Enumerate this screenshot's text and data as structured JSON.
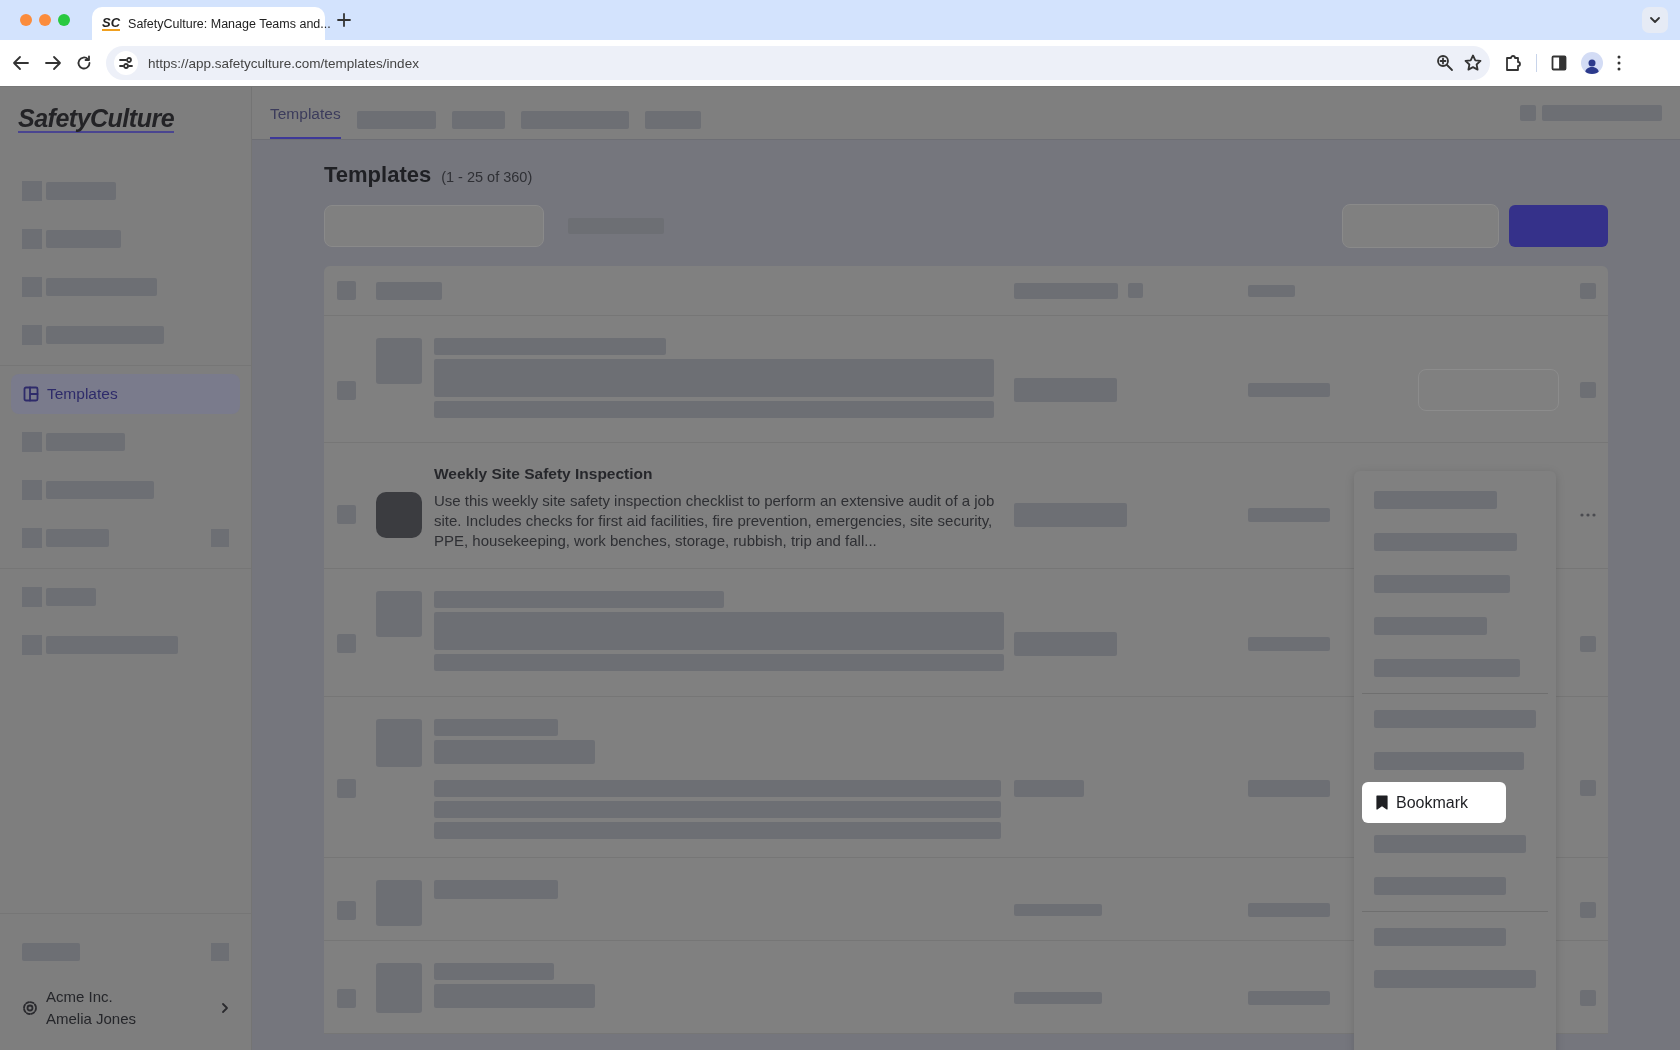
{
  "browser": {
    "favicon": "SC",
    "tab_title": "SafetyCulture: Manage Teams and...",
    "url": "https://app.safetyculture.com/templates/index"
  },
  "sidebar": {
    "logo": "SafetyCulture",
    "groups": [
      [
        {
          "kind": "placeholder",
          "selected": false
        },
        {
          "kind": "placeholder",
          "selected": false
        },
        {
          "kind": "placeholder",
          "selected": false
        },
        {
          "kind": "placeholder",
          "selected": false
        }
      ],
      [
        {
          "kind": "link",
          "label": "Templates",
          "selected": true
        },
        {
          "kind": "placeholder",
          "selected": false
        },
        {
          "kind": "placeholder",
          "selected": false
        },
        {
          "kind": "placeholder",
          "selected": false
        }
      ],
      [
        {
          "kind": "placeholder",
          "selected": false
        },
        {
          "kind": "placeholder",
          "selected": false
        }
      ]
    ],
    "account": {
      "org": "Acme Inc.",
      "user": "Amelia Jones"
    }
  },
  "header_tabs": [
    {
      "kind": "tab",
      "label": "Templates",
      "selected": true
    },
    {
      "kind": "placeholder",
      "selected": false
    },
    {
      "kind": "placeholder",
      "selected": false
    },
    {
      "kind": "placeholder",
      "selected": false
    },
    {
      "kind": "placeholder",
      "selected": false
    }
  ],
  "page": {
    "title": "Templates",
    "count": "(1 - 25 of 360)"
  },
  "table": {
    "rows": [
      {
        "kind": "placeholder"
      },
      {
        "kind": "template",
        "title": "Weekly Site Safety Inspection",
        "description": "Use this weekly site safety inspection checklist to perform an extensive audit of a job site. Includes checks for first aid facilities, fire prevention, emergencies, site security, PPE, housekeeping, work benches, storage, rubbish, trip and fall...",
        "menu_open": true
      },
      {
        "kind": "placeholder"
      },
      {
        "kind": "placeholder"
      },
      {
        "kind": "placeholder"
      },
      {
        "kind": "placeholder"
      }
    ]
  },
  "menu": {
    "items": [
      {
        "kind": "placeholder"
      },
      {
        "kind": "placeholder"
      },
      {
        "kind": "placeholder"
      },
      {
        "kind": "placeholder"
      },
      {
        "kind": "placeholder"
      },
      {
        "kind": "divider"
      },
      {
        "kind": "placeholder"
      },
      {
        "kind": "placeholder"
      },
      {
        "kind": "action",
        "label": "Bookmark",
        "highlighted": true
      },
      {
        "kind": "placeholder"
      },
      {
        "kind": "placeholder"
      },
      {
        "kind": "divider"
      },
      {
        "kind": "placeholder"
      },
      {
        "kind": "placeholder"
      }
    ]
  }
}
